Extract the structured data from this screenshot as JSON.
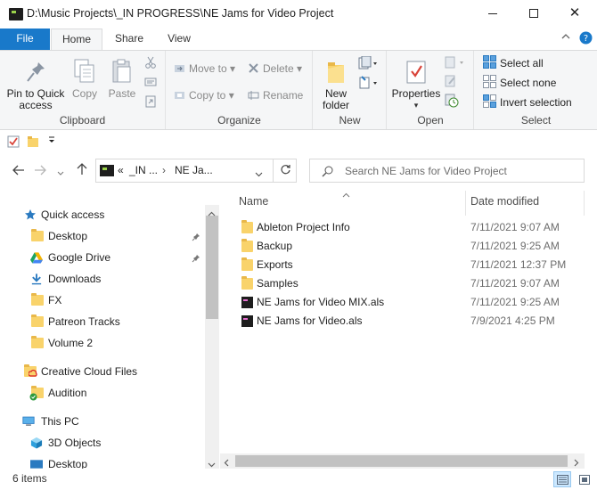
{
  "window": {
    "title": "D:\\Music Projects\\_IN PROGRESS\\NE Jams for Video Project",
    "minimize": "—",
    "maximize": "☐",
    "close": "✕"
  },
  "ribbon_tabs": [
    "File",
    "Home",
    "Share",
    "View"
  ],
  "ribbon": {
    "clipboard": {
      "pin_label_1": "Pin to Quick",
      "pin_label_2": "access",
      "copy": "Copy",
      "paste": "Paste",
      "group": "Clipboard"
    },
    "organize": {
      "move_to": "Move to",
      "copy_to": "Copy to",
      "delete": "Delete",
      "rename": "Rename",
      "group": "Organize"
    },
    "new": {
      "new_folder_1": "New",
      "new_folder_2": "folder",
      "group": "New"
    },
    "open": {
      "properties": "Properties",
      "group": "Open"
    },
    "select": {
      "select_all": "Select all",
      "select_none": "Select none",
      "invert": "Invert selection",
      "group": "Select"
    }
  },
  "address": {
    "seg1": "_IN ...",
    "seg2": "NE Ja...",
    "prefix": "«"
  },
  "search": {
    "placeholder": "Search NE Jams for Video Project"
  },
  "nav": {
    "quick_access": "Quick access",
    "items": [
      {
        "label": "Desktop",
        "icon": "folder-icon",
        "pinned": true
      },
      {
        "label": "Google Drive",
        "icon": "google-drive-icon",
        "pinned": true
      },
      {
        "label": "Downloads",
        "icon": "download-icon",
        "pinned": false
      },
      {
        "label": "FX",
        "icon": "folder-icon",
        "pinned": false
      },
      {
        "label": "Patreon Tracks",
        "icon": "folder-icon",
        "pinned": false
      },
      {
        "label": "Volume 2",
        "icon": "folder-icon",
        "pinned": false
      }
    ],
    "creative_cloud": "Creative Cloud Files",
    "audition": "Audition",
    "this_pc": "This PC",
    "objects_3d": "3D Objects",
    "desktop2": "Desktop"
  },
  "file_list": {
    "columns": {
      "name": "Name",
      "date": "Date modified"
    },
    "rows": [
      {
        "name": "Ableton Project Info",
        "date": "7/11/2021 9:07 AM",
        "type": "folder"
      },
      {
        "name": "Backup",
        "date": "7/11/2021 9:25 AM",
        "type": "folder"
      },
      {
        "name": "Exports",
        "date": "7/11/2021 12:37 PM",
        "type": "folder"
      },
      {
        "name": "Samples",
        "date": "7/11/2021 9:07 AM",
        "type": "folder"
      },
      {
        "name": "NE Jams for Video MIX.als",
        "date": "7/11/2021 9:25 AM",
        "type": "als"
      },
      {
        "name": "NE Jams for Video.als",
        "date": "7/9/2021 4:25 PM",
        "type": "als"
      }
    ]
  },
  "status": {
    "item_count": "6 items"
  },
  "colors": {
    "accent": "#1979ca",
    "folder": "#f9d36b",
    "selection": "#cce8ff"
  }
}
